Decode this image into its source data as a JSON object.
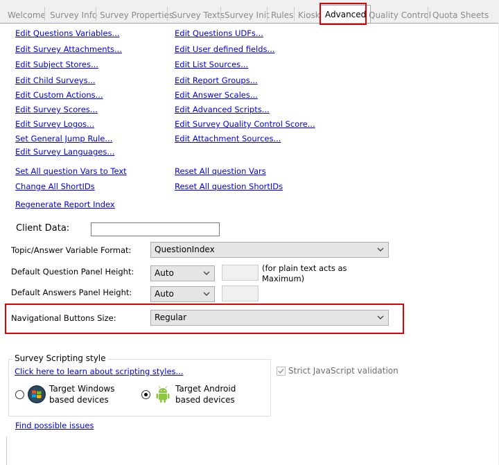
{
  "tabs": [
    "Welcome",
    "Survey Info",
    "Survey Properties",
    "Survey Texts",
    "Survey Init",
    "Rules",
    "Kiosk",
    "Advanced",
    "Quality Control",
    "Quota Sheets"
  ],
  "links_left": [
    "Edit Questions Variables...",
    "Edit Survey Attachments...",
    "Edit Subject Stores...",
    "Edit Child Surveys...",
    "Edit Custom Actions...",
    "Edit Survey Scores...",
    "Edit Survey Logos...",
    "Set General Jump Rule...",
    "Edit Survey Languages..."
  ],
  "links_right": [
    "Edit Questions UDFs...",
    "Edit User defined fields...",
    "Edit List Sources...",
    "Edit Report Groups...",
    "Edit Answer Scales...",
    "Edit Advanced Scripts...",
    "Edit Survey Quality Control Score...",
    "Edit Attachment Sources..."
  ],
  "actions": {
    "set_all_to_text": "Set All question Vars to Text",
    "reset_all_vars": "Reset All question Vars",
    "change_all_shortids": "Change All ShortIDs",
    "reset_all_shortids": "Reset All question ShortIDs",
    "regenerate_report_index": "Regenerate Report Index"
  },
  "client_data": {
    "label": "Client Data:",
    "value": ""
  },
  "topic_format": {
    "label": "Topic/Answer Variable Format:",
    "value": "QuestionIndex"
  },
  "question_panel": {
    "label": "Default Question Panel Height:",
    "value": "Auto",
    "note": "(for plain text acts as Maximum)"
  },
  "answers_panel": {
    "label": "Default Answers Panel Height:",
    "value": "Auto"
  },
  "nav_buttons": {
    "label": "Navigational Buttons Size:",
    "value": "Regular"
  },
  "scripting": {
    "title": "Survey Scripting style",
    "learn_link": "Click here to learn about scripting styles...",
    "windows_line1": "Target Windows",
    "windows_line2": "based devices",
    "android_line1": "Target Android",
    "android_line2": "based devices",
    "selected": "android"
  },
  "strict_js": {
    "label": "Strict JavaScript validation",
    "checked": true,
    "enabled": false
  },
  "find_issues": "Find possible issues",
  "colors": {
    "link": "#0000ee",
    "highlight": "#e00000",
    "android_green": "#8dc63f"
  },
  "icons": [
    "chevron-down-icon",
    "windows-logo-icon",
    "android-logo-icon",
    "checkmark-icon"
  ]
}
